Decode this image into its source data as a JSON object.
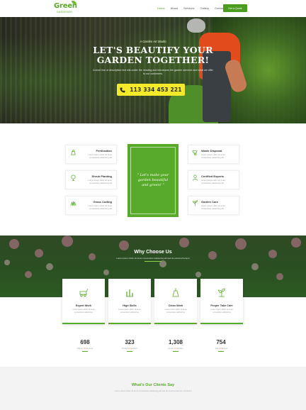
{
  "brand": {
    "logo_word": "Green",
    "logo_sub": "GARDENER"
  },
  "nav": {
    "items": [
      "Home",
      "About",
      "Services",
      "Gallery",
      "Contact"
    ],
    "active_index": 0,
    "cta_label": "Get a Quote"
  },
  "hero": {
    "tagline": "A Garden Art Studio",
    "title_line1": "LET'S BEAUTIFY YOUR",
    "title_line2": "GARDEN TOGETHER!",
    "text": "A short line of description text sits under the heading and introduces the garden services and what we offer to our customers.",
    "phone": "113 334 453 221"
  },
  "services": {
    "left": [
      {
        "title": "Fertilization",
        "desc": "Lorem ipsum dolor sit amet consectetur adipiscing elit",
        "icon": "fertilizer-icon"
      },
      {
        "title": "Shrub Planting",
        "desc": "Lorem ipsum dolor sit amet consectetur adipiscing elit",
        "icon": "shrub-icon"
      },
      {
        "title": "Grass Cutting",
        "desc": "Lorem ipsum dolor sit amet consectetur adipiscing elit",
        "icon": "grass-icon"
      }
    ],
    "right": [
      {
        "title": "Waste Disposal",
        "desc": "Lorem ipsum dolor sit amet consectetur adipiscing elit",
        "icon": "wheelbarrow-icon"
      },
      {
        "title": "Certified Experts",
        "desc": "Lorem ipsum dolor sit amet consectetur adipiscing elit",
        "icon": "expert-icon"
      },
      {
        "title": "Garden Care",
        "desc": "Lorem ipsum dolor sit amet consectetur adipiscing elit",
        "icon": "plant-icon"
      }
    ],
    "center_quote": "\" Let's make your garden beautiful and green! \""
  },
  "why": {
    "title": "Why Choose Us",
    "text": "Lorem ipsum dolor sit amet consectetur adipiscing elit sed do eiusmod tempor",
    "features": [
      {
        "title": "Expert Work",
        "desc": "Lorem ipsum dolor sit amet consectetur adipiscing",
        "icon": "mower-icon"
      },
      {
        "title": "High Skills",
        "desc": "Lorem ipsum dolor sit amet consectetur adipiscing",
        "icon": "skills-icon"
      },
      {
        "title": "Clean Work",
        "desc": "Lorem ipsum dolor sit amet consectetur adipiscing",
        "icon": "clean-icon"
      },
      {
        "title": "Proper Take Care",
        "desc": "Lorem ipsum dolor sit amet consectetur adipiscing",
        "icon": "care-icon"
      }
    ]
  },
  "stats": [
    {
      "value": "698",
      "label": "Happy Customers"
    },
    {
      "value": "323",
      "label": "Projects Finished"
    },
    {
      "value": "1,308",
      "label": "Acres Of Garden"
    },
    {
      "value": "754",
      "label": "Trees Planted"
    }
  ],
  "clients": {
    "title": "What's Our Clients Say",
    "text": "Lorem ipsum dolor sit amet consectetur adipiscing elit sed do eiusmod tempor incididunt"
  },
  "colors": {
    "brand_green": "#58ab2a",
    "cta_yellow": "#f4ea2a",
    "nav_button": "#4a9d1f"
  }
}
